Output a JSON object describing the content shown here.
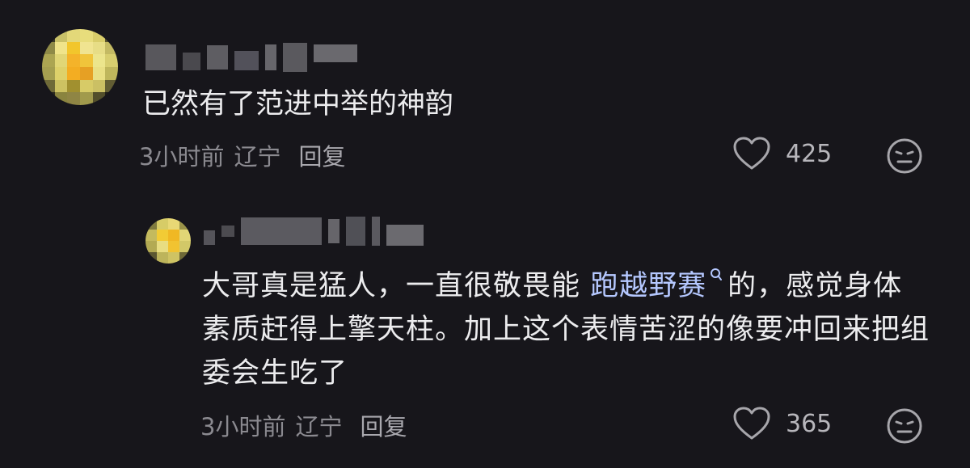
{
  "comments": [
    {
      "content": "已然有了范进中举的神韵",
      "time": "3小时前",
      "region": "辽宁",
      "reply_label": "回复",
      "like_count": "425"
    },
    {
      "content_before": "大哥真是猛人，一直很敬畏能 ",
      "link_text": "跑越野赛",
      "content_after": "的，感觉身体素质赶得上擎天柱。加上这个表情苦涩的像要冲回来把组委会生吃了",
      "time": "3小时前",
      "region": "辽宁",
      "reply_label": "回复",
      "like_count": "365"
    }
  ],
  "colors": {
    "background": "#17161b",
    "text": "#ececee",
    "meta": "#8b8a90",
    "link": "#b5c8ff",
    "icon": "#a7a6ab"
  },
  "icons": [
    "heart-icon",
    "search-icon",
    "expressionless-face-icon"
  ]
}
